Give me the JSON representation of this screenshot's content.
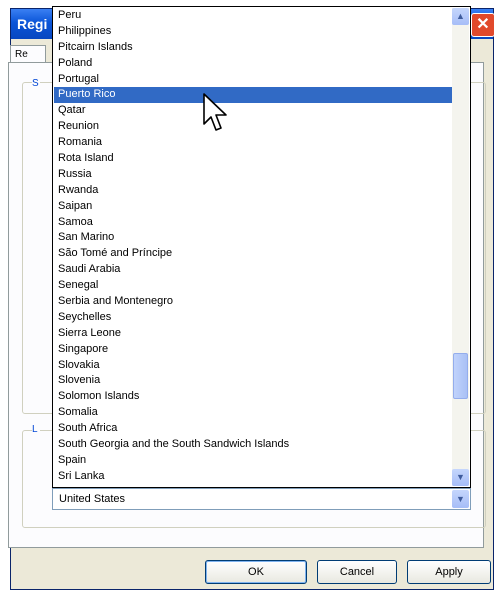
{
  "window": {
    "title": "Regi",
    "close_glyph": "✕",
    "tab_label": "Re"
  },
  "groups": {
    "group1_label": "S",
    "group2_label": "L"
  },
  "dropdown": {
    "items": [
      "Peru",
      "Philippines",
      "Pitcairn Islands",
      "Poland",
      "Portugal",
      "Puerto Rico",
      "Qatar",
      "Reunion",
      "Romania",
      "Rota Island",
      "Russia",
      "Rwanda",
      "Saipan",
      "Samoa",
      "San Marino",
      "São Tomé and Príncipe",
      "Saudi Arabia",
      "Senegal",
      "Serbia and Montenegro",
      "Seychelles",
      "Sierra Leone",
      "Singapore",
      "Slovakia",
      "Slovenia",
      "Solomon Islands",
      "Somalia",
      "South Africa",
      "South Georgia and the South Sandwich Islands",
      "Spain",
      "Sri Lanka"
    ],
    "highlighted": "Puerto Rico"
  },
  "select": {
    "value": "United States"
  },
  "buttons": {
    "ok": "OK",
    "cancel": "Cancel",
    "apply": "Apply"
  },
  "icons": {
    "scroll_up": "chevron-up-icon",
    "scroll_down": "chevron-down-icon",
    "dropdown_arrow": "chevron-down-icon"
  },
  "colors": {
    "selection": "#316ac5",
    "titlebar": "#0b55d8",
    "close": "#e1492b"
  }
}
